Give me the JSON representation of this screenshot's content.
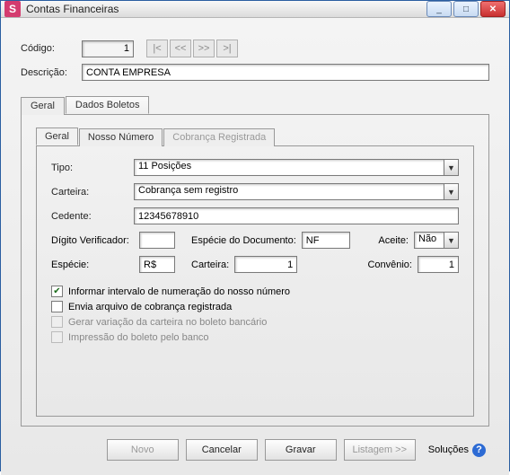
{
  "window": {
    "title": "Contas Financeiras"
  },
  "header": {
    "codigo_label": "Código:",
    "codigo_value": "1",
    "descricao_label": "Descrição:",
    "descricao_value": "CONTA EMPRESA"
  },
  "nav": {
    "first": "|<",
    "prev": "<<",
    "next": ">>",
    "last": ">|"
  },
  "tabs": {
    "geral": "Geral",
    "dados": "Dados Boletos"
  },
  "innerTabs": {
    "geral": "Geral",
    "nosso": "Nosso Número",
    "cobranca": "Cobrança Registrada"
  },
  "form": {
    "tipo_label": "Tipo:",
    "tipo_value": "11 Posições",
    "carteira_label": "Carteira:",
    "carteira_value": "Cobrança sem registro",
    "cedente_label": "Cedente:",
    "cedente_value": "12345678910",
    "digito_label": "Dígito Verificador:",
    "digito_value": "",
    "especie_doc_label": "Espécie do Documento:",
    "especie_doc_value": "NF",
    "aceite_label": "Aceite:",
    "aceite_value": "Não",
    "especie_label": "Espécie:",
    "especie_value": "R$",
    "carteira2_label": "Carteira:",
    "carteira2_value": "1",
    "convenio_label": "Convênio:",
    "convenio_value": "1",
    "chk1": "Informar intervalo de numeração do nosso número",
    "chk2": "Envia arquivo de cobrança registrada",
    "chk3": "Gerar variação da carteira no boleto bancário",
    "chk4": "Impressão do boleto pelo banco"
  },
  "buttons": {
    "novo": "Novo",
    "cancelar": "Cancelar",
    "gravar": "Gravar",
    "listagem": "Listagem >>",
    "solucoes": "Soluções"
  },
  "icons": {
    "app": "S",
    "dropdown": "▼",
    "check": "✔",
    "help": "?",
    "min": "_",
    "max": "□",
    "close": "✕"
  }
}
